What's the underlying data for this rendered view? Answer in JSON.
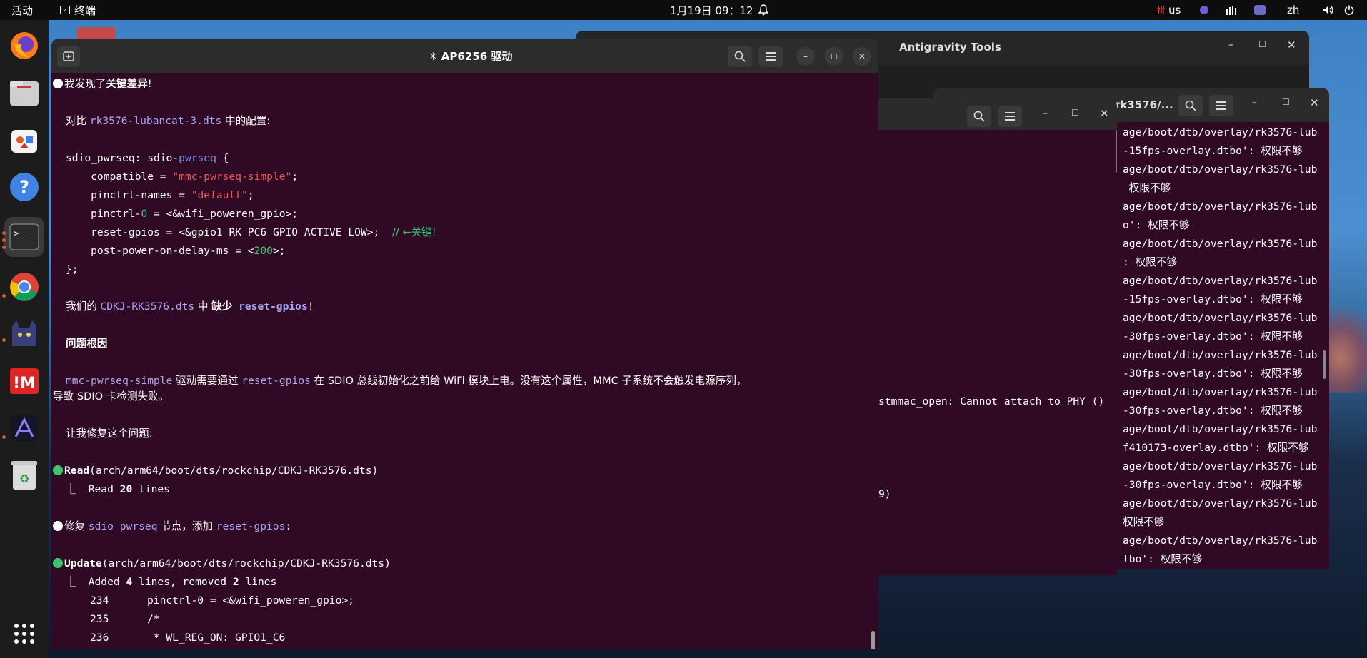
{
  "topbar": {
    "activities": "活动",
    "app_name": "终端",
    "clock": "1月19日  09：12",
    "keyboard": "us",
    "lang": "zh"
  },
  "dock": {
    "items": [
      "firefox-icon",
      "files-icon",
      "app-center-icon",
      "help-icon",
      "terminal-icon",
      "chrome-icon",
      "cat-app-icon",
      "foxit-icon",
      "antigravity-icon",
      "trash-icon",
      "app-grid-icon"
    ]
  },
  "back_window": {
    "title": "Antigravity Tools"
  },
  "mid_window": {
    "title": "rk3576/...",
    "lines": [
      "age/boot/dtb/overlay/rk3576-lub",
      "-15fps-overlay.dtbo': 权限不够",
      "age/boot/dtb/overlay/rk3576-lub",
      " 权限不够",
      "age/boot/dtb/overlay/rk3576-lub",
      "o': 权限不够",
      "age/boot/dtb/overlay/rk3576-lub",
      ": 权限不够",
      "age/boot/dtb/overlay/rk3576-lub",
      "-15fps-overlay.dtbo': 权限不够",
      "age/boot/dtb/overlay/rk3576-lub",
      "-30fps-overlay.dtbo': 权限不够",
      "age/boot/dtb/overlay/rk3576-lub",
      "-30fps-overlay.dtbo': 权限不够",
      "age/boot/dtb/overlay/rk3576-lub",
      "-30fps-overlay.dtbo': 权限不够",
      "age/boot/dtb/overlay/rk3576-lub",
      "f410173-overlay.dtbo': 权限不够",
      "age/boot/dtb/overlay/rk3576-lub",
      "-30fps-overlay.dtbo': 权限不够",
      "age/boot/dtb/overlay/rk3576-lub",
      "权限不够",
      "age/boot/dtb/overlay/rk3576-lub",
      "tbo': 权限不够"
    ]
  },
  "mid2_window": {
    "line1": "stmmac_open: Cannot attach to PHY ()",
    "line2": "9)"
  },
  "main_window": {
    "title": "✳ AP6256 驱动",
    "found_prefix": "我发现了",
    "found_bold": "关键差异",
    "found_suffix": "!",
    "compare_prefix": "对比 ",
    "compare_file": "rk3576-lubancat-3.dts",
    "compare_suffix": " 中的配置:",
    "code": {
      "l1a": "sdio_pwrseq: sdio-",
      "l1b": "pwrseq",
      "l1c": " {",
      "l2a": "    compatible = ",
      "l2b": "\"mmc-pwrseq-simple\"",
      "l2c": ";",
      "l3a": "    pinctrl-names = ",
      "l3b": "\"default\"",
      "l3c": ";",
      "l4a": "    pinctrl-",
      "l4b": "0",
      "l4c": " = <&wifi_poweren_gpio>;",
      "l5a": "    reset-gpios = <&gpio1 RK_PC6 GPIO_ACTIVE_LOW>;  ",
      "l5b": "// ←关键!",
      "l6a": "    post-power-on-delay-ms = <",
      "l6b": "200",
      "l6c": ">;",
      "l7": "};"
    },
    "missing_prefix": "我们的 ",
    "missing_file": "CDKJ-RK3576.dts",
    "missing_mid": " 中 ",
    "missing_bold": "缺少",
    "missing_sp": " ",
    "missing_prop": "reset-gpios",
    "missing_suffix": "!",
    "root_cause": "问题根因",
    "explain_a": "mmc-pwrseq-simple",
    "explain_b": " 驱动需要通过 ",
    "explain_c": "reset-gpios",
    "explain_d": " 在 SDIO 总线初始化之前给 WiFi 模块上电。没有这个属性，MMC 子系统不会触发电源序列，",
    "explain_e": "导致 SDIO 卡检测失败。",
    "fix_intro": "让我修复这个问题:",
    "read_label": "Read",
    "read_path": "(arch/arm64/boot/dts/rockchip/CDKJ-RK3576.dts)",
    "read_result_a": "  ⎿  Read ",
    "read_result_b": "20",
    "read_result_c": " lines",
    "fix_a": "修复 ",
    "fix_b": "sdio_pwrseq",
    "fix_c": " 节点，添加 ",
    "fix_d": "reset-gpios",
    "fix_e": ":",
    "update_label": "Update",
    "update_path": "(arch/arm64/boot/dts/rockchip/CDKJ-RK3576.dts)",
    "update_result_a": "  ⎿  Added ",
    "update_result_b": "4",
    "update_result_c": " lines, removed ",
    "update_result_d": "2",
    "update_result_e": " lines",
    "diff": [
      {
        "num": "234",
        "text": "pinctrl-0 = <&wifi_poweren_gpio>;"
      },
      {
        "num": "235",
        "text": "/*"
      },
      {
        "num": "236",
        "text": " * WL_REG_ON: GPIO1_C6"
      }
    ]
  }
}
